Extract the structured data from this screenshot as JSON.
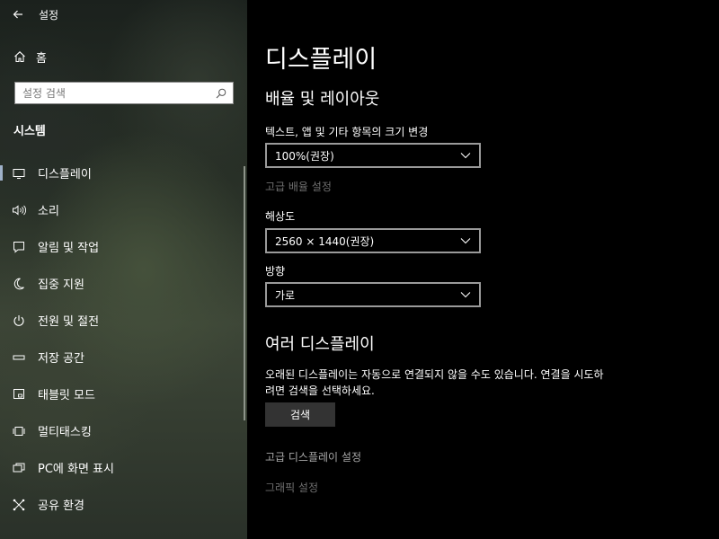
{
  "app": {
    "title": "설정"
  },
  "sidebar": {
    "home_label": "홈",
    "search_placeholder": "설정 검색",
    "section_title": "시스템",
    "items": [
      {
        "label": "디스플레이",
        "icon": "monitor-icon",
        "selected": true
      },
      {
        "label": "소리",
        "icon": "speaker-icon"
      },
      {
        "label": "알림 및 작업",
        "icon": "notification-icon"
      },
      {
        "label": "집중 지원",
        "icon": "moon-icon"
      },
      {
        "label": "전원 및 절전",
        "icon": "power-icon"
      },
      {
        "label": "저장 공간",
        "icon": "storage-icon"
      },
      {
        "label": "태블릿 모드",
        "icon": "tablet-mode-icon"
      },
      {
        "label": "멀티태스킹",
        "icon": "multitasking-icon"
      },
      {
        "label": "PC에 화면 표시",
        "icon": "project-icon"
      },
      {
        "label": "공유 환경",
        "icon": "shared-experiences-icon"
      }
    ]
  },
  "main": {
    "page_title": "디스플레이",
    "scale_section": {
      "heading": "배율 및 레이아웃",
      "text_size_label": "텍스트, 앱 및 기타 항목의 크기 변경",
      "text_size_value": "100%(권장)",
      "advanced_scaling_link": "고급 배율 설정",
      "resolution_label": "해상도",
      "resolution_value": "2560 × 1440(권장)",
      "orientation_label": "방향",
      "orientation_value": "가로"
    },
    "multi_section": {
      "heading": "여러 디스플레이",
      "description": "오래된 디스플레이는 자동으로 연결되지 않을 수도 있습니다. 연결을 시도하려면 검색을 선택하세요.",
      "detect_button": "검색",
      "advanced_display_link": "고급 디스플레이 설정",
      "graphics_settings_link": "그래픽 설정"
    }
  },
  "colors": {
    "accent": "#9fb1c9",
    "background": "#000000",
    "dim_link": "#6f6f6f"
  }
}
